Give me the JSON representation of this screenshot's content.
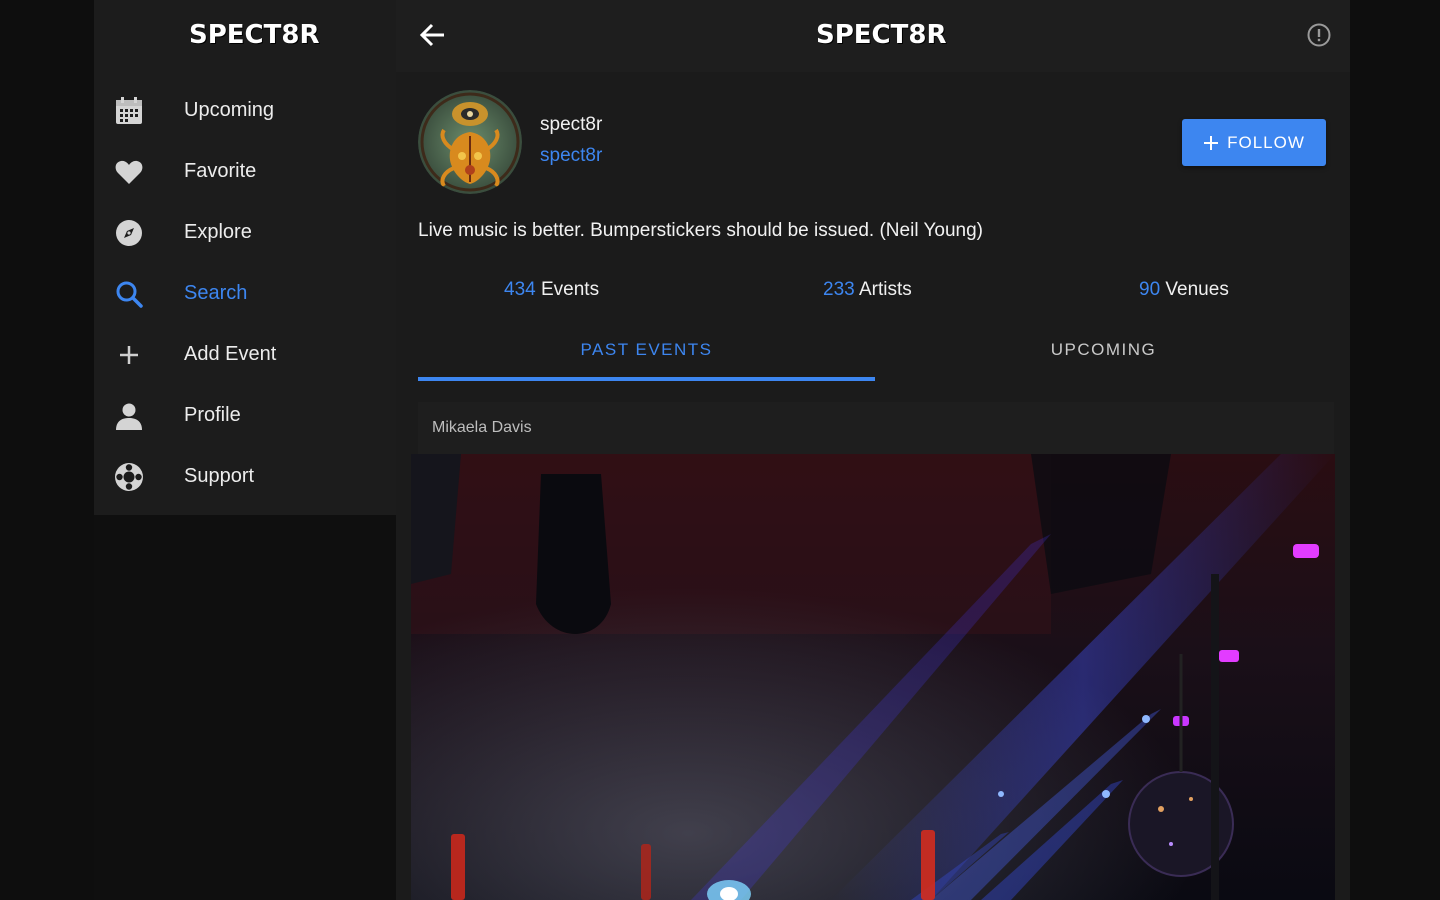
{
  "app": {
    "brand": "SPECT8R",
    "accent_color": "#3d86f0"
  },
  "sidebar": {
    "brand": "SPECT8R",
    "items": [
      {
        "label": "Upcoming",
        "icon": "calendar-icon",
        "active": false
      },
      {
        "label": "Favorite",
        "icon": "heart-icon",
        "active": false
      },
      {
        "label": "Explore",
        "icon": "compass-icon",
        "active": false
      },
      {
        "label": "Search",
        "icon": "search-icon",
        "active": true
      },
      {
        "label": "Add Event",
        "icon": "plus-icon",
        "active": false
      },
      {
        "label": "Profile",
        "icon": "person-icon",
        "active": false
      },
      {
        "label": "Support",
        "icon": "lifebuoy-icon",
        "active": false
      }
    ]
  },
  "header": {
    "title": "SPECT8R",
    "back_icon": "back-arrow-icon",
    "info_icon": "info-icon"
  },
  "profile": {
    "username": "spect8r",
    "handle": "spect8r",
    "follow_label": "FOLLOW",
    "bio": "Live music is better. Bumperstickers should be issued. (Neil Young)",
    "stats": [
      {
        "value": "434",
        "label": "Events"
      },
      {
        "value": "233",
        "label": "Artists"
      },
      {
        "value": "90",
        "label": "Venues"
      }
    ]
  },
  "tabs": [
    {
      "label": "PAST EVENTS",
      "active": true
    },
    {
      "label": "UPCOMING",
      "active": false
    }
  ],
  "feed": {
    "cards": [
      {
        "author": "Mikaela Davis"
      }
    ]
  }
}
